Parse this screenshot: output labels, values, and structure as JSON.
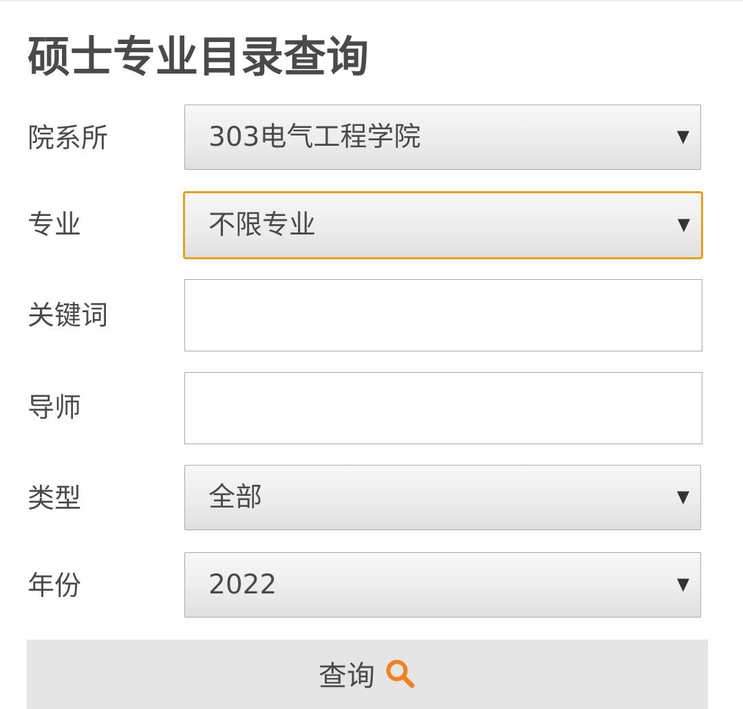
{
  "page": {
    "title": "硕士专业目录查询"
  },
  "form": {
    "department": {
      "label": "院系所",
      "selected": "303电气工程学院"
    },
    "major": {
      "label": "专业",
      "selected": "不限专业"
    },
    "keyword": {
      "label": "关键词",
      "value": ""
    },
    "supervisor": {
      "label": "导师",
      "value": ""
    },
    "type": {
      "label": "类型",
      "selected": "全部"
    },
    "year": {
      "label": "年份",
      "selected": "2022"
    },
    "submit": {
      "label": "查询",
      "icon": "search-icon"
    }
  },
  "colors": {
    "focus_border": "#e8a21a",
    "search_icon": "#f0821e",
    "button_bg": "#e5e5e5",
    "text": "#4a4a4a"
  }
}
